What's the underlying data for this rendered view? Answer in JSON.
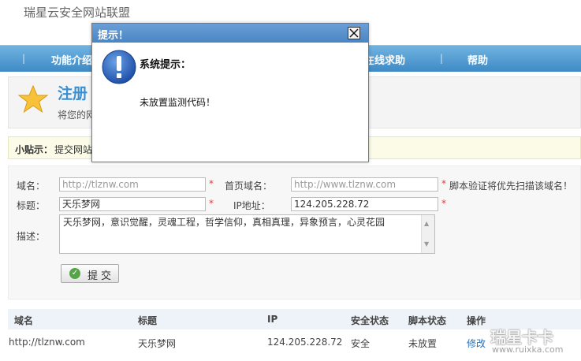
{
  "site": {
    "title": "瑞星云安全网站联盟"
  },
  "nav": {
    "items": [
      {
        "label": "功能介绍"
      },
      {
        "label": "在线求助"
      },
      {
        "label": "帮助"
      }
    ]
  },
  "register": {
    "title": "注册",
    "description": "将您的网"
  },
  "tips": {
    "label": "小贴示：",
    "text": "提交网站"
  },
  "form": {
    "domain_label": "域名：",
    "domain_placeholder": "http://tlznw.com",
    "home_label": "首页域名：",
    "home_placeholder": "http://www.tlznw.com",
    "home_hint": "脚本验证将优先扫描该域名！",
    "title_label": "标题：",
    "title_value": "天乐梦网",
    "ip_label": "IP地址：",
    "ip_value": "124.205.228.72",
    "desc_label": "描述：",
    "desc_value": "天乐梦网，意识觉醒，灵魂工程，哲学信仰，真相真理，异象预言，心灵花园",
    "required_mark": "*",
    "submit_label": "提交"
  },
  "table": {
    "headers": [
      "域名",
      "标题",
      "IP",
      "安全状态",
      "脚本状态",
      "操作"
    ],
    "rows": [
      {
        "domain": "http://tlznw.com",
        "title": "天乐梦网",
        "ip": "124.205.228.72",
        "security": "安全",
        "script": "未放置",
        "action": "修改"
      }
    ]
  },
  "watermark": {
    "line1": "瑞星卡卡",
    "line2": "www.ruixka.com"
  },
  "dialog": {
    "title": "提示！",
    "heading": "系统提示：",
    "message": "未放置监测代码！"
  },
  "colors": {
    "nav_blue": "#4a90cc",
    "dialog_title_blue": "#5b93cf",
    "accent_blue": "#3a8fd0",
    "required_red": "#e23b3b"
  }
}
